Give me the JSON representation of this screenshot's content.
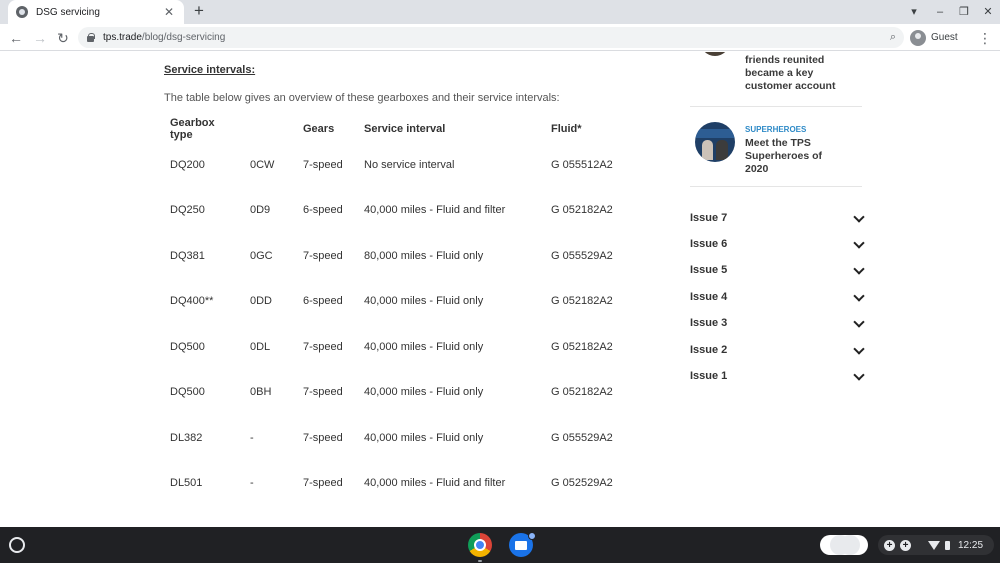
{
  "browser": {
    "tab_title": "DSG servicing",
    "tab_close": "✕",
    "new_tab": "+",
    "url_domain": "tps.trade",
    "url_path": "/blog/dsg-servicing",
    "profile_label": "Guest"
  },
  "article": {
    "section_heading": "Service intervals:",
    "intro": "The table below gives an overview of these gearboxes and their service intervals:",
    "table": {
      "headers": [
        "Gearbox type",
        "",
        "Gears",
        "Service interval",
        "Fluid*"
      ],
      "rows": [
        [
          "DQ200",
          "0CW",
          "7-speed",
          "No service interval",
          "G 055512A2"
        ],
        [
          "DQ250",
          "0D9",
          "6-speed",
          "40,000 miles - Fluid and filter",
          "G 052182A2"
        ],
        [
          "DQ381",
          "0GC",
          "7-speed",
          "80,000 miles - Fluid only",
          "G 055529A2"
        ],
        [
          "DQ400**",
          "0DD",
          "6-speed",
          "40,000 miles - Fluid only",
          "G 052182A2"
        ],
        [
          "DQ500",
          "0DL",
          "7-speed",
          "40,000 miles - Fluid only",
          "G 052182A2"
        ],
        [
          "DQ500",
          "0BH",
          "7-speed",
          "40,000 miles - Fluid only",
          "G 052182A2"
        ],
        [
          "DL382",
          "-",
          "7-speed",
          "40,000 miles - Fluid only",
          "G 055529A2"
        ],
        [
          "DL501",
          "-",
          "7-speed",
          "40,000 miles - Fluid and filter",
          "G 052529A2"
        ]
      ]
    }
  },
  "sidebar": {
    "card1_lines": [
      "friends reunited",
      "became a key",
      "customer account"
    ],
    "card2_category": "SUPERHEROES",
    "card2_lines": [
      "Meet the TPS",
      "Superheroes of",
      "2020"
    ],
    "issues": [
      "Issue 7",
      "Issue 6",
      "Issue 5",
      "Issue 4",
      "Issue 3",
      "Issue 2",
      "Issue 1"
    ]
  },
  "shelf": {
    "time": "12:25"
  },
  "colors": {
    "accent_link": "#2e8ac7",
    "shelf_bg": "#202124",
    "tabstrip_bg": "#dee1e6"
  }
}
